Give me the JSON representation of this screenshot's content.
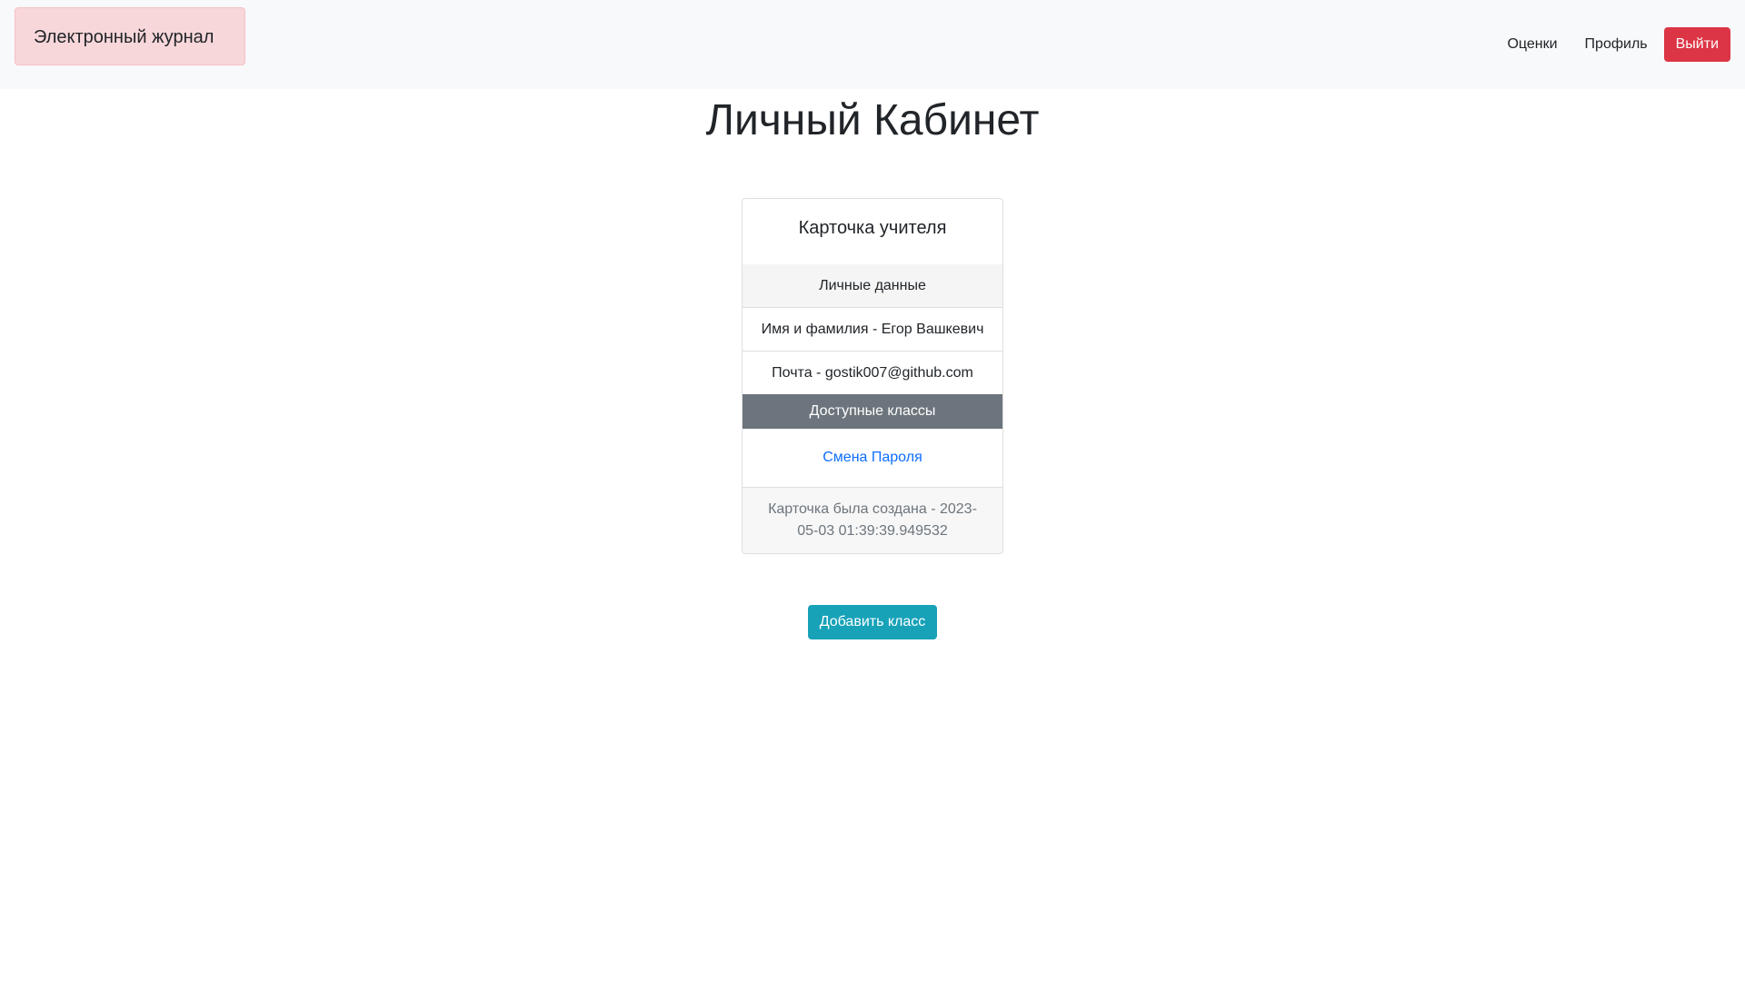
{
  "navbar": {
    "brand": "Электронный журнал",
    "links": [
      "Оценки",
      "Профиль"
    ],
    "logout_label": "Выйти"
  },
  "page": {
    "title": "Личный Кабинет"
  },
  "card": {
    "title": "Карточка учителя",
    "personal_data_header": "Личные данные",
    "name_line": "Имя и фамилия - Егор Вашкевич",
    "email_line": "Почта - gostik007@github.com",
    "classes_button": "Доступные классы",
    "change_password_link": "Смена Пароля",
    "footer": "Карточка была создана - 2023-05-03 01:39:39.949532"
  },
  "actions": {
    "add_class_label": "Добавить класс"
  },
  "colors": {
    "brand_bg": "#f8d7da",
    "danger": "#dc3545",
    "secondary": "#6c757d",
    "info": "#17a2b8",
    "link": "#0d6efd"
  }
}
